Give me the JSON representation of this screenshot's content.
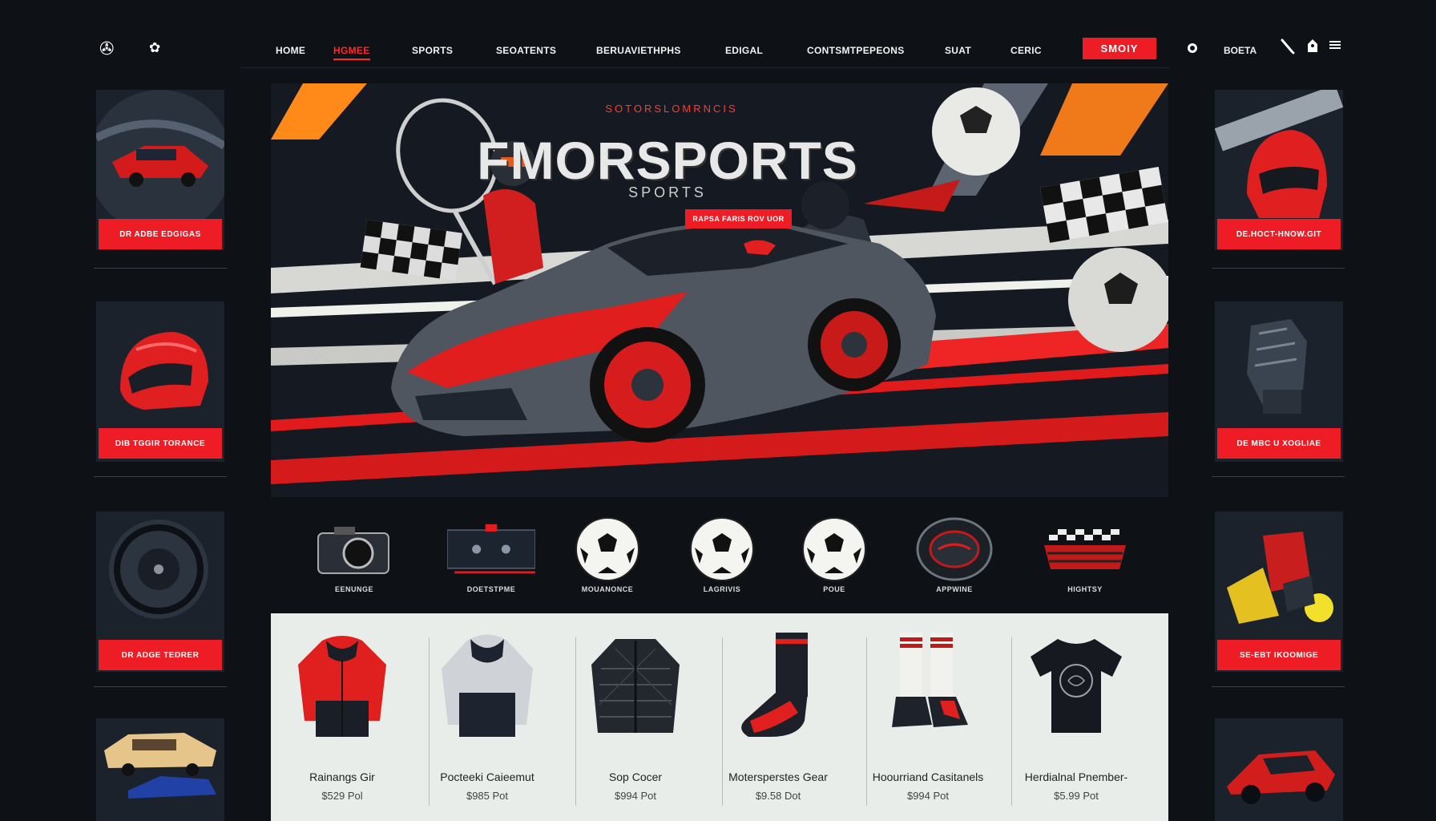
{
  "nav": {
    "logo_glyph": "✇",
    "logo2_glyph": "✿",
    "items": [
      "HOME",
      "HGMEE",
      "SPORTS",
      "SEOATENTS",
      "BERUAVIETHPHS",
      "EDIGAL",
      "CONTSMTPEPEONS",
      "SUAT",
      "CERIC"
    ],
    "active_index": 1,
    "cta": "SMOIY",
    "user": "BOETA",
    "icons": [
      "circle-icon",
      "pencil-icon",
      "bag-icon",
      "menu-icon"
    ]
  },
  "hero": {
    "kicker": "SOTORSLOMRNCIS",
    "title": "FMORSPORTS",
    "subtitle": "SPORTS",
    "button": "RAPSA FARIS ROV UOR"
  },
  "left_cards": [
    {
      "button": "DR ADBE EDGIGAS",
      "image": "red-car"
    },
    {
      "button": "DIB TGGIR TORANCE",
      "image": "red-helmet"
    },
    {
      "button": "DR ADGE TEDRER",
      "image": "steering-wheel"
    },
    {
      "button": "",
      "image": "vintage-car"
    }
  ],
  "right_cards": [
    {
      "button": "DE.HOCT-HNOW.GIT",
      "image": "helmet-closeup"
    },
    {
      "button": "DE MBC U XOGLIAE",
      "image": "gloves"
    },
    {
      "button": "SE-EBT IKOOMIGE",
      "image": "sports-gear"
    },
    {
      "button": "",
      "image": "race-car"
    }
  ],
  "categories": [
    {
      "label": "EENUNGE",
      "icon": "camera-icon"
    },
    {
      "label": "DOETSTPME",
      "icon": "dashboard-icon"
    },
    {
      "label": "MOUANONCE",
      "icon": "soccer-ball-icon"
    },
    {
      "label": "LAGRIVIS",
      "icon": "soccer-ball-icon"
    },
    {
      "label": "POUE",
      "icon": "soccer-ball-icon"
    },
    {
      "label": "APPWINE",
      "icon": "tire-icon"
    },
    {
      "label": "HIGHTSY",
      "icon": "checkered-flag-icon"
    }
  ],
  "products": [
    {
      "name": "Rainangs Gir",
      "price": "$529 Pol",
      "item": "red-jacket"
    },
    {
      "name": "Pocteeki Caieemut",
      "price": "$985 Pot",
      "item": "grey-hoodie"
    },
    {
      "name": "Sop Cocer",
      "price": "$994 Pot",
      "item": "quilted-jacket"
    },
    {
      "name": "Motersperstes Gear",
      "price": "$9.58 Dot",
      "item": "racing-sock"
    },
    {
      "name": "Hoourriand Casitanels",
      "price": "$994 Pot",
      "item": "sneaker-socks"
    },
    {
      "name": "Herdialnal Pnember-",
      "price": "$5.99 Pot",
      "item": "t-shirt"
    }
  ],
  "colors": {
    "accent": "#ee1c24",
    "background": "#0e1116",
    "panel": "#e9ede9",
    "card": "#1b222c"
  }
}
